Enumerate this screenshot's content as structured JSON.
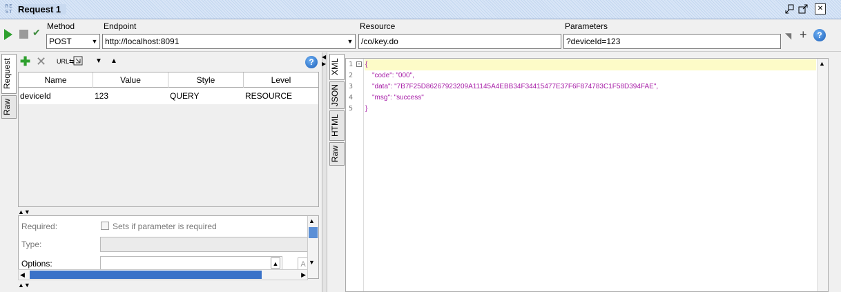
{
  "window": {
    "badge": "RE ST",
    "title": "Request 1",
    "controls": [
      "restore-icon",
      "popout-icon",
      "close-icon"
    ]
  },
  "toolbar": {
    "method_label": "Method",
    "method_value": "POST",
    "endpoint_label": "Endpoint",
    "endpoint_value": "http://localhost:8091",
    "resource_label": "Resource",
    "resource_value": "/co/key.do",
    "parameters_label": "Parameters",
    "parameters_value": "?deviceId=123"
  },
  "left_tabs": [
    "Request",
    "Raw"
  ],
  "params_table": {
    "columns": [
      "Name",
      "Value",
      "Style",
      "Level"
    ],
    "rows": [
      {
        "name": "deviceId",
        "value": "123",
        "style": "QUERY",
        "level": "RESOURCE"
      }
    ]
  },
  "details": {
    "required_label": "Required:",
    "required_checkbox_label": "Sets if parameter is required",
    "type_label": "Type:",
    "options_label": "Options:",
    "options_button": "A"
  },
  "right_tabs": [
    "XML",
    "JSON",
    "HTML",
    "Raw"
  ],
  "response": {
    "line_numbers": [
      "1",
      "2",
      "3",
      "4",
      "5"
    ],
    "open_brace": "{",
    "close_brace": "}",
    "lines": [
      {
        "key": "\"code\"",
        "value": "\"000\"",
        "suffix": ","
      },
      {
        "key": "\"data\"",
        "value": "\"7B7F25D86267923209A11145A4EBB34F34415477E37F6F874783C1F58D394FAE\"",
        "suffix": ","
      },
      {
        "key": "\"msg\"",
        "value": "\"success\"",
        "suffix": ""
      }
    ]
  },
  "colors": {
    "json_purple": "#a61aa6",
    "highlight_line": "#fdfbc8",
    "play_green": "#2ea02e",
    "scroll_blue": "#3a72c8"
  }
}
